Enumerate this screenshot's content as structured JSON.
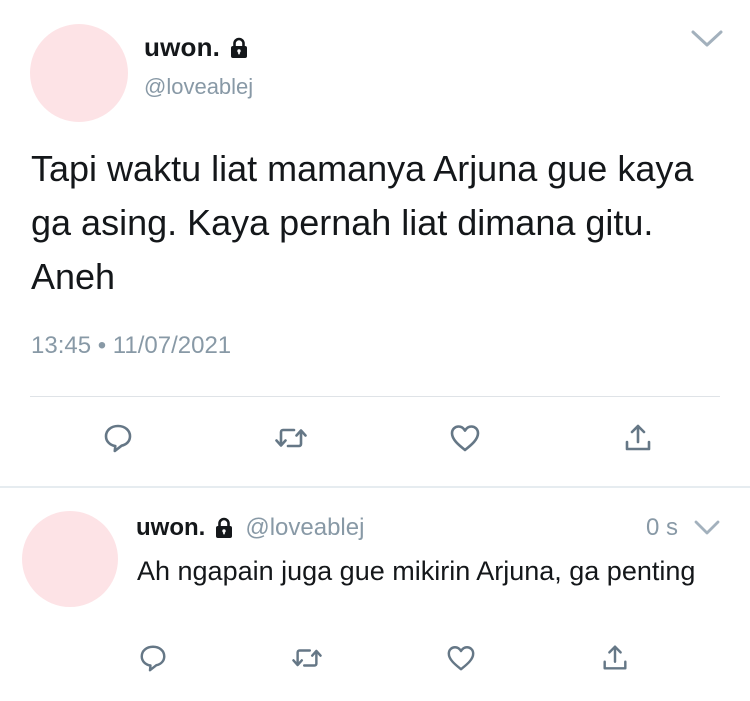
{
  "main_tweet": {
    "display_name": "uwon.",
    "handle": "@loveablej",
    "text": "Tapi waktu liat mamanya Arjuna gue kaya ga asing. Kaya pernah liat dimana gitu. Aneh",
    "timestamp": "13:45 • 11/07/2021",
    "avatar_color": "#fde3e6",
    "icons": [
      "lock-icon",
      "chevron-down-icon",
      "reply-icon",
      "retweet-icon",
      "like-icon",
      "share-icon"
    ]
  },
  "reply_tweet": {
    "display_name": "uwon.",
    "handle": "@loveablej",
    "relative_time": "0 s",
    "text": "Ah ngapain juga gue mikirin Arjuna, ga penting",
    "avatar_color": "#fde3e6",
    "icons": [
      "lock-icon",
      "chevron-down-icon",
      "reply-icon",
      "retweet-icon",
      "like-icon",
      "share-icon"
    ]
  },
  "colors": {
    "text_primary": "#14171a",
    "text_secondary": "#8899a6",
    "icon": "#657786",
    "divider": "#e6ecf0"
  }
}
